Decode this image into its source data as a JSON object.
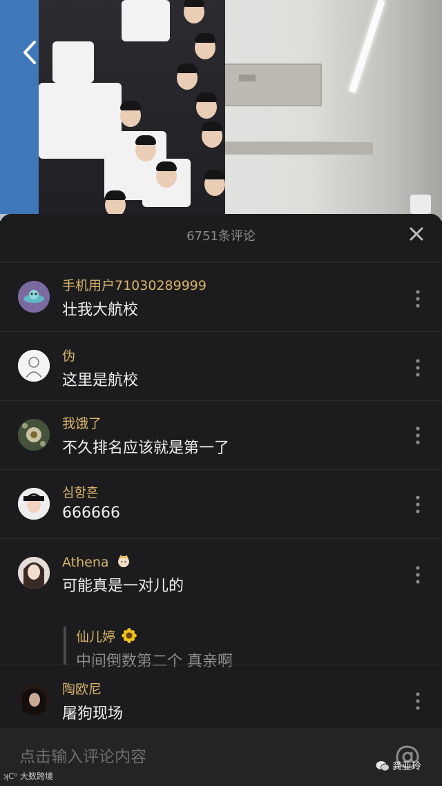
{
  "sheet": {
    "title": "6751条评论",
    "close_icon": "close-icon"
  },
  "comments": [
    {
      "name": "手机用户71030289999",
      "text": "壮我大航校",
      "avatar": "alien-avatar"
    },
    {
      "name": "伪",
      "text": "这里是航校",
      "avatar": "sketch-avatar"
    },
    {
      "name": "我饿了",
      "text": "不久排名应该就是第一了",
      "avatar": "flower-avatar"
    },
    {
      "name": "심항흔",
      "text": "666666",
      "avatar": "person-avatar"
    },
    {
      "name": "Athena",
      "name_badge": "crown-icon",
      "text": "可能真是一对儿的",
      "avatar": "girl-avatar",
      "reply": {
        "name": "仙儿婷",
        "name_badge": "sunflower-icon",
        "text": "中间倒数第二个  真亲啊"
      }
    },
    {
      "name": "陶欧尼",
      "text": "屠狗现场",
      "avatar": "dark-avatar"
    }
  ],
  "input": {
    "placeholder": "点击输入评论内容",
    "at_icon": "at-icon"
  },
  "watermark": {
    "left": "大数跨境",
    "right": "龚亚玲"
  },
  "colors": {
    "sheet_bg": "#1c1c1e",
    "username": "#d9b46b",
    "comment_text": "#f0f0f0",
    "muted": "#8c8c8e"
  }
}
